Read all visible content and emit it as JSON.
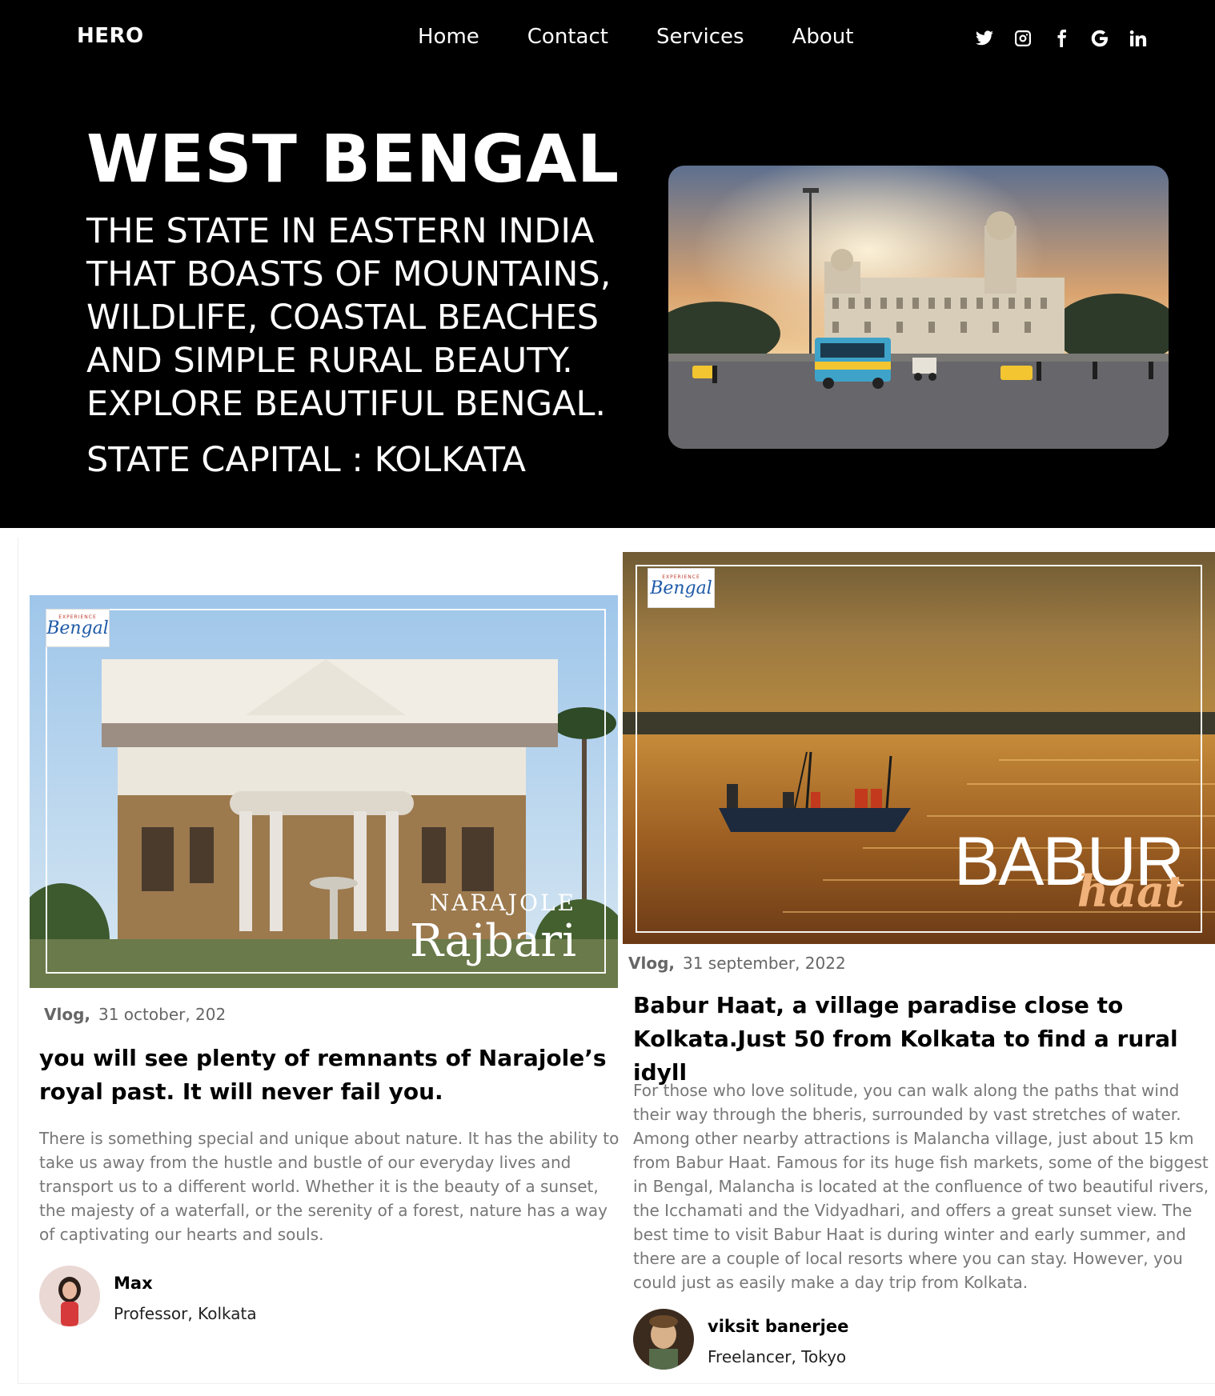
{
  "nav": {
    "logo": "HERO",
    "links": [
      "Home",
      "Contact",
      "Services",
      "About"
    ],
    "social_icons": [
      "twitter-icon",
      "instagram-icon",
      "facebook-icon",
      "google-icon",
      "linkedin-icon"
    ]
  },
  "hero": {
    "title": "WEST BENGAL",
    "subtitle": "THE STATE IN EASTERN INDIA THAT BOASTS OF MOUNTAINS, WILDLIFE, COASTAL BEACHES AND SIMPLE RURAL BEAUTY. EXPLORE BEAUTIFUL BENGAL.",
    "capital": "STATE CAPITAL : KOLKATA"
  },
  "cards": [
    {
      "image_text_top": "NARAJOLE",
      "image_text_bottom": "Rajbari",
      "badge": "Bengal",
      "category": "Vlog,",
      "date": "31 october, 202",
      "title": "you will see plenty of remnants of Narajole’s royal past. It will never fail you.",
      "body": "There is something special and unique about nature. It has the ability to take us away from the hustle and bustle of our everyday lives and transport us to a different world. Whether it is the beauty of a sunset, the majesty of a waterfall, or the serenity of a forest, nature has a way of captivating our hearts and souls.",
      "author_name": "Max",
      "author_role": "Professor, Kolkata"
    },
    {
      "image_text_top": "BABUR",
      "image_text_bottom": "haat",
      "badge": "Bengal",
      "category": "Vlog,",
      "date": "31 september, 2022",
      "title": "Babur Haat, a village paradise close to Kolkata.Just 50 from Kolkata to find a rural idyll",
      "body": "For those who love solitude, you can walk along the paths that wind their way through the bheris, surrounded by vast stretches of water. Among other nearby attractions is Malancha village, just about 15 km from Babur Haat. Famous for its huge fish markets, some of the biggest in Bengal, Malancha is located at the confluence of two beautiful rivers, the Icchamati and the Vidyadhari, and offers a great sunset view. The best time to visit Babur Haat is during winter and early summer, and there are a couple of local resorts where you can stay. However, you could just as easily make a day trip from Kolkata.",
      "author_name": "viksit banerjee",
      "author_role": "Freelancer, Tokyo"
    }
  ]
}
